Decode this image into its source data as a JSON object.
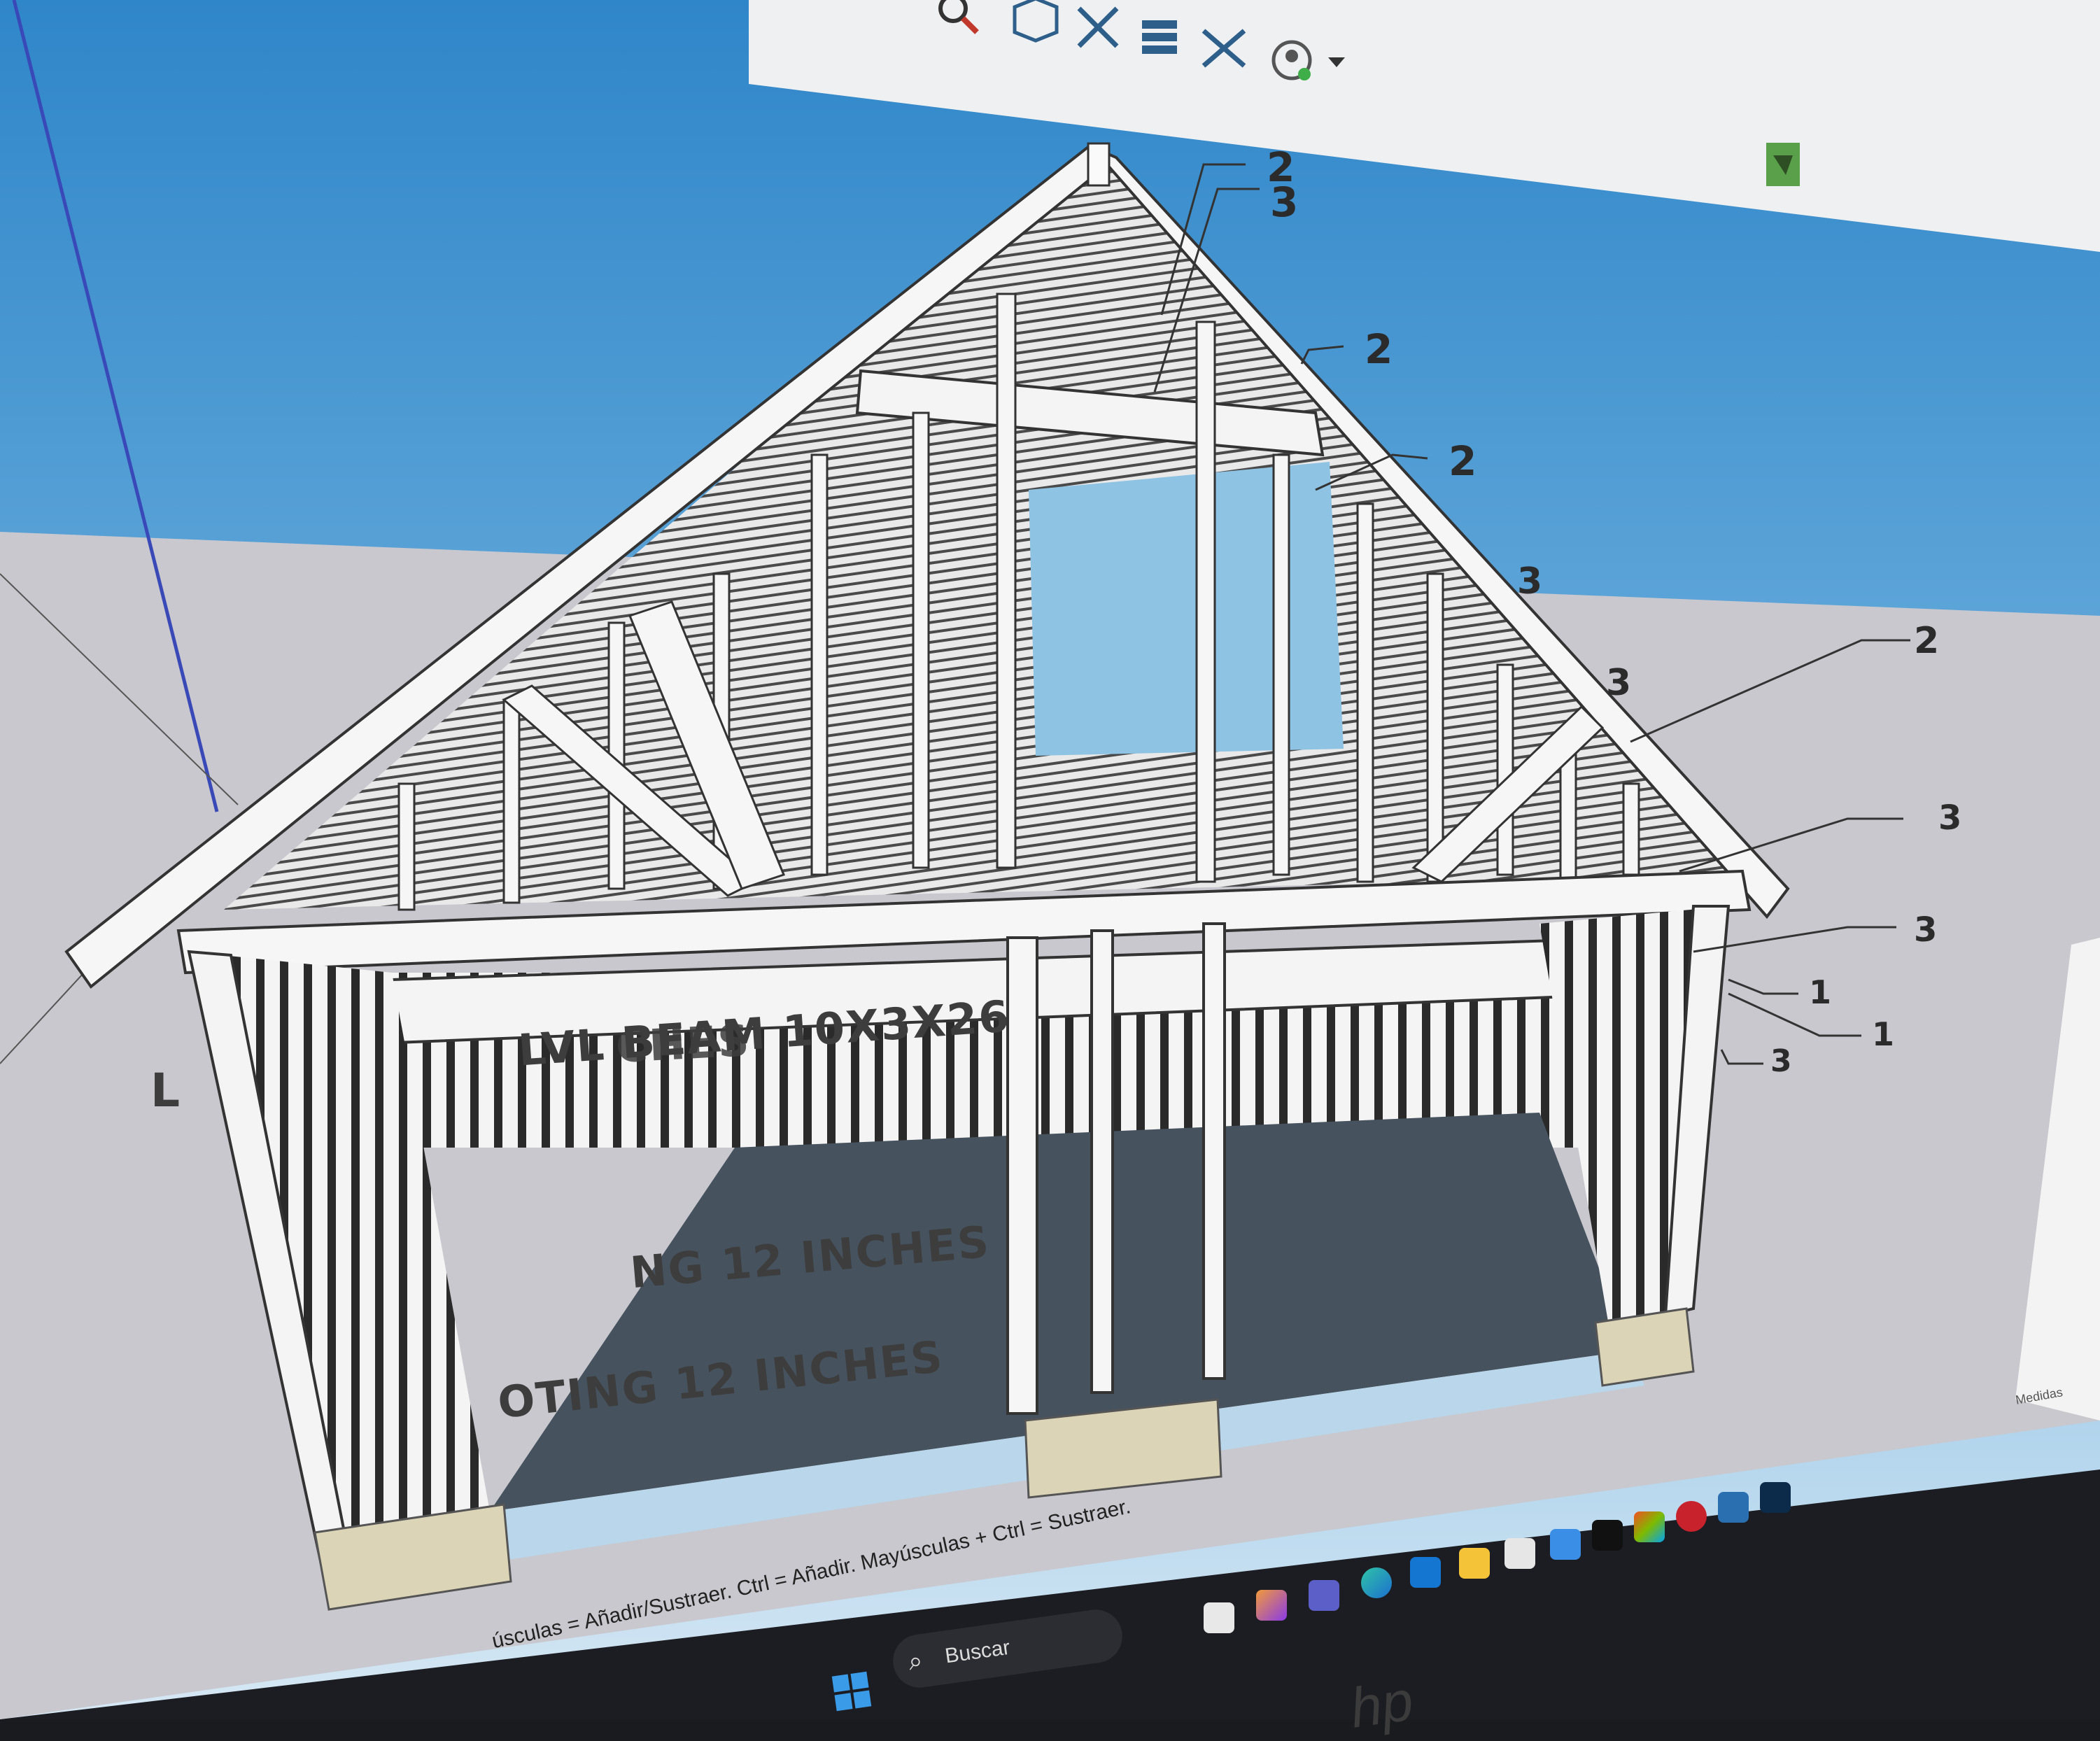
{
  "app": {
    "viewport": {
      "callouts": [
        {
          "id": "c1",
          "text": "2"
        },
        {
          "id": "c2",
          "text": "3"
        },
        {
          "id": "c3",
          "text": "2"
        },
        {
          "id": "c4",
          "text": "2"
        },
        {
          "id": "c5",
          "text": "3"
        },
        {
          "id": "c6",
          "text": "2"
        },
        {
          "id": "c7",
          "text": "3"
        },
        {
          "id": "c8",
          "text": "3"
        },
        {
          "id": "c9",
          "text": "3"
        },
        {
          "id": "c10",
          "text": "1"
        },
        {
          "id": "c11",
          "text": "1"
        },
        {
          "id": "c12",
          "text": "3"
        }
      ],
      "beam_label": "LVL BEAM 10X3X26",
      "beam_label_ghost": "CHES",
      "footing_label_1": "NG 12 INCHES",
      "footing_label_2": "OTING 12 INCHES",
      "left_partial_label": "L"
    },
    "toolbar": {
      "icons": [
        "search-icon",
        "component-icon",
        "section-plane-icon",
        "layers-icon",
        "section-fill-icon",
        "user-account-icon"
      ]
    },
    "status_bar": {
      "hint": "úsculas = Añadir/Sustraer. Ctrl = Añadir. Mayúsculas + Ctrl = Sustraer."
    },
    "right_panel": {
      "measurements_label": "Medidas"
    },
    "taskbar": {
      "search_placeholder": "Buscar",
      "brand": "hp"
    },
    "colors": {
      "sky_top": "#3b8fcf",
      "sky_bottom": "#cfe2f1",
      "ground": "#c9c9cf",
      "slab": "#4a5560",
      "lumber": "#f2f2f2",
      "footing": "#d8d2b8",
      "taskbar": "#1c1d22"
    }
  }
}
